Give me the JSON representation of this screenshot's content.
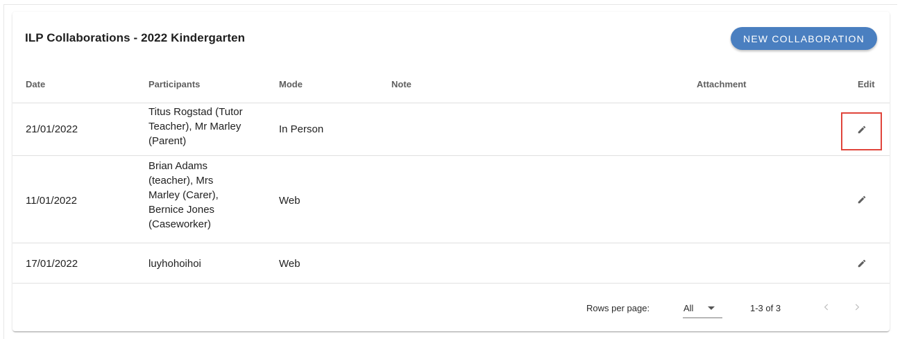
{
  "card": {
    "title": "ILP Collaborations - 2022 Kindergarten",
    "new_button_label": "NEW COLLABORATION"
  },
  "table": {
    "headers": {
      "date": "Date",
      "participants": "Participants",
      "mode": "Mode",
      "note": "Note",
      "attachment": "Attachment",
      "edit": "Edit"
    },
    "rows": [
      {
        "date": "21/01/2022",
        "participants_lines": [
          "Titus Rogstad (Tutor",
          "Teacher), Mr Marley",
          "(Parent)"
        ],
        "mode": "In Person",
        "note": "",
        "attachment": "",
        "edit_icon": "pencil-icon"
      },
      {
        "date": "11/01/2022",
        "participants_lines": [
          "Brian Adams",
          "(teacher), Mrs",
          "Marley (Carer),",
          "Bernice Jones",
          "(Caseworker)"
        ],
        "mode": "Web",
        "note": "",
        "attachment": "",
        "edit_icon": "pencil-icon"
      },
      {
        "date": "17/01/2022",
        "participants_lines": [
          "luyhohoihoi"
        ],
        "mode": "Web",
        "note": "",
        "attachment": "",
        "edit_icon": "pencil-icon"
      }
    ]
  },
  "pagination": {
    "rows_per_page_label": "Rows per page:",
    "rows_per_page_value": "All",
    "range_text": "1-3 of 3",
    "prev_icon": "chevron-left-icon",
    "next_icon": "chevron-right-icon"
  },
  "colors": {
    "accent": "#4a7fc0",
    "highlight": "#e0443a",
    "icon": "#5f5f5f",
    "disabled_icon": "#bdbdbd"
  }
}
